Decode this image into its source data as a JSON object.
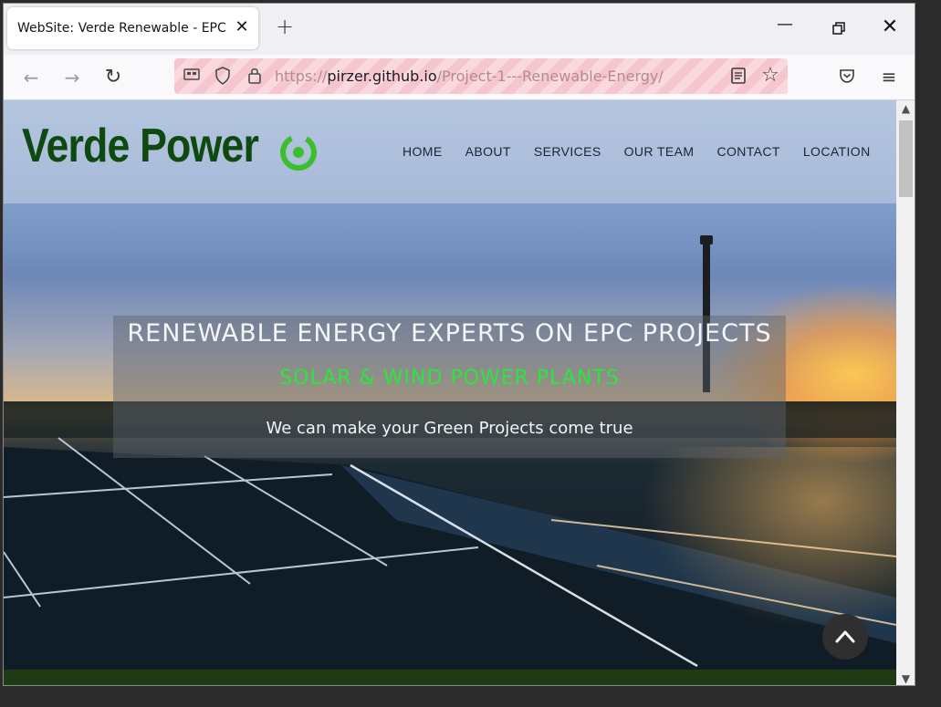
{
  "browser": {
    "tab_title": "WebSite: Verde Renewable - EPC Co",
    "url_scheme": "https://",
    "url_host": "pirzer.github.io",
    "url_path": "/Project-1---Renewable-Energy/"
  },
  "site": {
    "logo": "Verde Power",
    "nav": [
      "HOME",
      "ABOUT",
      "SERVICES",
      "OUR TEAM",
      "CONTACT",
      "LOCATION"
    ],
    "hero_title": "RENEWABLE ENERGY EXPERTS ON EPC PROJECTS",
    "hero_subtitle": "SOLAR & WIND POWER PLANTS",
    "hero_tagline": "We can make your Green Projects come true"
  },
  "colors": {
    "logo_green": "#0d4a10",
    "accent_green": "#2be63c",
    "header_overlay": "rgba(200,210,230,0.55)"
  },
  "icons": [
    "close-icon",
    "plus-icon",
    "minimize-icon",
    "restore-icon",
    "back-arrow-icon",
    "forward-arrow-icon",
    "reload-icon",
    "permissions-icon",
    "shield-icon",
    "lock-icon",
    "reader-view-icon",
    "star-icon",
    "pocket-icon",
    "menu-icon",
    "power-icon",
    "chevron-up-icon"
  ]
}
